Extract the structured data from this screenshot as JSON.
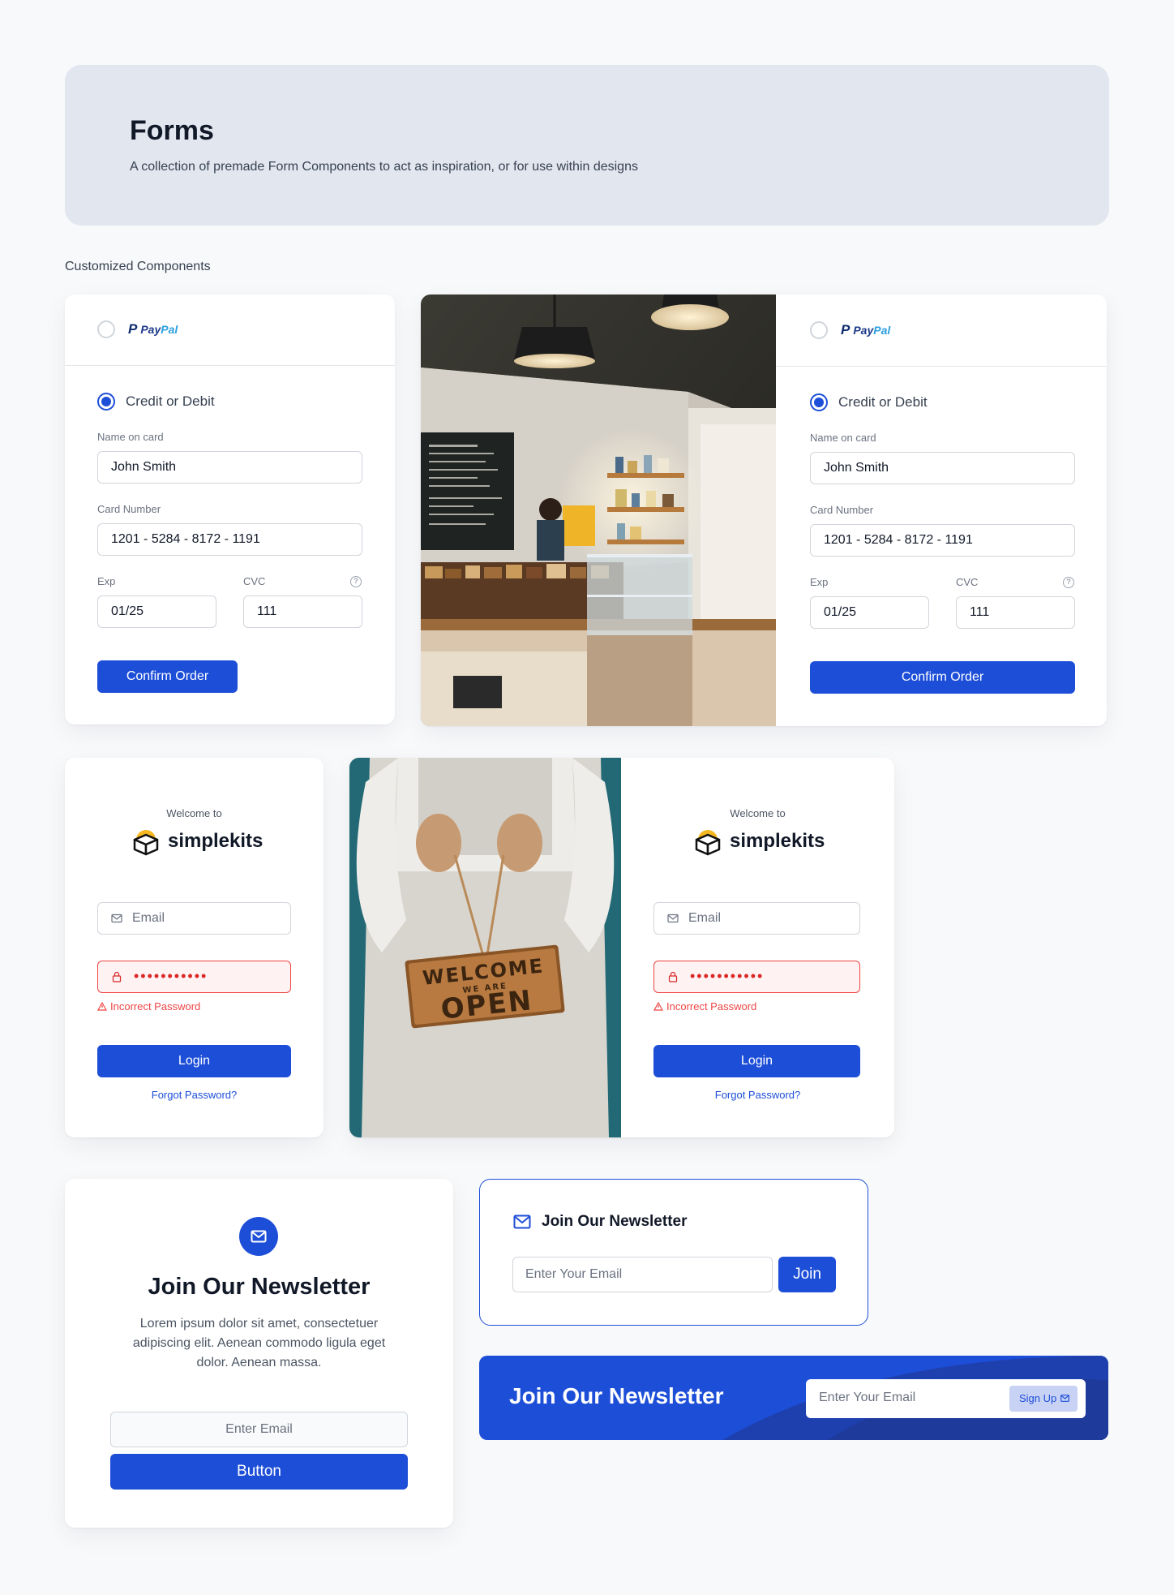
{
  "header": {
    "title": "Forms",
    "subtitle": "A collection of premade Form Components to act as inspiration, or for use within designs"
  },
  "section_label": "Customized Components",
  "payment": {
    "paypal_pay": "Pay",
    "paypal_pal": "Pal",
    "credit_label": "Credit or Debit",
    "name_label": "Name on card",
    "name_value": "John Smith",
    "number_label": "Card Number",
    "number_value": "1201 - 5284 - 8172 - 1191",
    "exp_label": "Exp",
    "exp_value": "01/25",
    "cvc_label": "CVC",
    "cvc_value": "111",
    "confirm_label": "Confirm Order"
  },
  "login": {
    "welcome": "Welcome to",
    "brand": "simplekits",
    "email_placeholder": "Email",
    "password_mask": "•••••••••••",
    "error": "Incorrect Password",
    "login_label": "Login",
    "forgot_label": "Forgot Password?"
  },
  "newsletter_card": {
    "title": "Join Our Newsletter",
    "body": "Lorem ipsum dolor sit amet, consectetuer adipiscing elit. Aenean commodo ligula eget dolor. Aenean massa.",
    "input_placeholder": "Enter Email",
    "button_label": "Button"
  },
  "newsletter_inline": {
    "title": "Join Our Newsletter",
    "input_placeholder": "Enter Your Email",
    "button_label": "Join"
  },
  "newsletter_banner": {
    "title": "Join Our Newsletter",
    "input_placeholder": "Enter Your Email",
    "button_label": "Sign Up"
  },
  "photo_sign": {
    "line1": "WELCOME",
    "line2": "WE ARE",
    "line3": "OPEN"
  },
  "colors": {
    "accent": "#1d4ed8",
    "error": "#ef4444",
    "hero_bg": "#e2e6ef"
  }
}
